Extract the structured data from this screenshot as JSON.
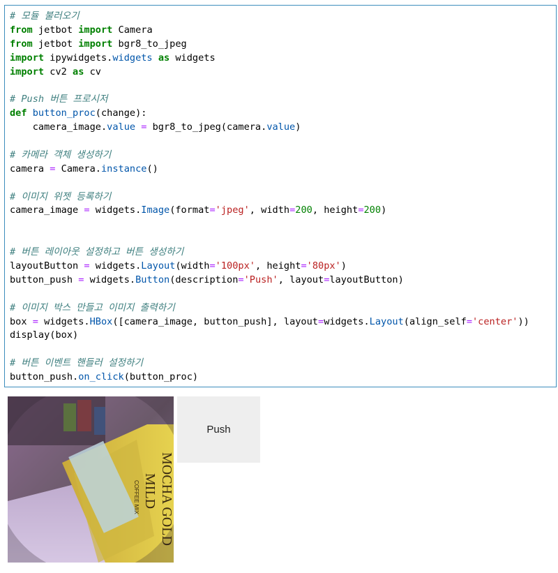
{
  "code_cell": {
    "lines": [
      [
        {
          "t": "comment",
          "v": "# 모듈 불러오기"
        }
      ],
      [
        {
          "t": "kw",
          "v": "from"
        },
        {
          "t": "plain",
          "v": " jetbot "
        },
        {
          "t": "kw",
          "v": "import"
        },
        {
          "t": "plain",
          "v": " Camera"
        }
      ],
      [
        {
          "t": "kw",
          "v": "from"
        },
        {
          "t": "plain",
          "v": " jetbot "
        },
        {
          "t": "kw",
          "v": "import"
        },
        {
          "t": "plain",
          "v": " bgr8_to_jpeg"
        }
      ],
      [
        {
          "t": "kw",
          "v": "import"
        },
        {
          "t": "plain",
          "v": " ipywidgets."
        },
        {
          "t": "attr",
          "v": "widgets"
        },
        {
          "t": "plain",
          "v": " "
        },
        {
          "t": "kw",
          "v": "as"
        },
        {
          "t": "plain",
          "v": " widgets"
        }
      ],
      [
        {
          "t": "kw",
          "v": "import"
        },
        {
          "t": "plain",
          "v": " cv2 "
        },
        {
          "t": "kw",
          "v": "as"
        },
        {
          "t": "plain",
          "v": " cv"
        }
      ],
      [],
      [
        {
          "t": "comment",
          "v": "# Push 버튼 프로시저"
        }
      ],
      [
        {
          "t": "kw",
          "v": "def"
        },
        {
          "t": "plain",
          "v": " "
        },
        {
          "t": "attr",
          "v": "button_proc"
        },
        {
          "t": "plain",
          "v": "(change):"
        }
      ],
      [
        {
          "t": "plain",
          "v": "    camera_image."
        },
        {
          "t": "attr",
          "v": "value"
        },
        {
          "t": "plain",
          "v": " "
        },
        {
          "t": "op",
          "v": "="
        },
        {
          "t": "plain",
          "v": " bgr8_to_jpeg(camera."
        },
        {
          "t": "attr",
          "v": "value"
        },
        {
          "t": "plain",
          "v": ")"
        }
      ],
      [],
      [
        {
          "t": "comment",
          "v": "# 카메라 객체 생성하기"
        }
      ],
      [
        {
          "t": "plain",
          "v": "camera "
        },
        {
          "t": "op",
          "v": "="
        },
        {
          "t": "plain",
          "v": " Camera."
        },
        {
          "t": "attr",
          "v": "instance"
        },
        {
          "t": "plain",
          "v": "()"
        }
      ],
      [],
      [
        {
          "t": "comment",
          "v": "# 이미지 위젯 등록하기"
        }
      ],
      [
        {
          "t": "plain",
          "v": "camera_image "
        },
        {
          "t": "op",
          "v": "="
        },
        {
          "t": "plain",
          "v": " widgets."
        },
        {
          "t": "attr",
          "v": "Image"
        },
        {
          "t": "plain",
          "v": "(format"
        },
        {
          "t": "op",
          "v": "="
        },
        {
          "t": "str",
          "v": "'jpeg'"
        },
        {
          "t": "plain",
          "v": ", width"
        },
        {
          "t": "op",
          "v": "="
        },
        {
          "t": "num",
          "v": "200"
        },
        {
          "t": "plain",
          "v": ", height"
        },
        {
          "t": "op",
          "v": "="
        },
        {
          "t": "num",
          "v": "200"
        },
        {
          "t": "plain",
          "v": ")"
        }
      ],
      [],
      [],
      [
        {
          "t": "comment",
          "v": "# 버튼 레이아웃 설정하고 버튼 생성하기"
        }
      ],
      [
        {
          "t": "plain",
          "v": "layoutButton "
        },
        {
          "t": "op",
          "v": "="
        },
        {
          "t": "plain",
          "v": " widgets."
        },
        {
          "t": "attr",
          "v": "Layout"
        },
        {
          "t": "plain",
          "v": "(width"
        },
        {
          "t": "op",
          "v": "="
        },
        {
          "t": "str",
          "v": "'100px'"
        },
        {
          "t": "plain",
          "v": ", height"
        },
        {
          "t": "op",
          "v": "="
        },
        {
          "t": "str",
          "v": "'80px'"
        },
        {
          "t": "plain",
          "v": ")"
        }
      ],
      [
        {
          "t": "plain",
          "v": "button_push "
        },
        {
          "t": "op",
          "v": "="
        },
        {
          "t": "plain",
          "v": " widgets."
        },
        {
          "t": "attr",
          "v": "Button"
        },
        {
          "t": "plain",
          "v": "(description"
        },
        {
          "t": "op",
          "v": "="
        },
        {
          "t": "str",
          "v": "'Push'"
        },
        {
          "t": "plain",
          "v": ", layout"
        },
        {
          "t": "op",
          "v": "="
        },
        {
          "t": "plain",
          "v": "layoutButton)"
        }
      ],
      [],
      [
        {
          "t": "comment",
          "v": "# 이미지 박스 만들고 이미지 출력하기"
        }
      ],
      [
        {
          "t": "plain",
          "v": "box "
        },
        {
          "t": "op",
          "v": "="
        },
        {
          "t": "plain",
          "v": " widgets."
        },
        {
          "t": "attr",
          "v": "HBox"
        },
        {
          "t": "plain",
          "v": "([camera_image, button_push], layout"
        },
        {
          "t": "op",
          "v": "="
        },
        {
          "t": "plain",
          "v": "widgets."
        },
        {
          "t": "attr",
          "v": "Layout"
        },
        {
          "t": "plain",
          "v": "(align_self"
        },
        {
          "t": "op",
          "v": "="
        },
        {
          "t": "str",
          "v": "'center'"
        },
        {
          "t": "plain",
          "v": "))"
        }
      ],
      [
        {
          "t": "plain",
          "v": "display(box)"
        }
      ],
      [],
      [
        {
          "t": "comment",
          "v": "# 버튼 이벤트 핸들러 설정하기"
        }
      ],
      [
        {
          "t": "plain",
          "v": "button_push."
        },
        {
          "t": "attr",
          "v": "on_click"
        },
        {
          "t": "plain",
          "v": "(button_proc)"
        }
      ]
    ]
  },
  "output": {
    "image_label_line1": "MOCHA GOLD",
    "image_label_line2": "MILD",
    "image_label_line3": "COFFEE MIX",
    "push_button_label": "Push"
  },
  "colors": {
    "cell_border": "#3c8dbc",
    "keyword": "#008000",
    "comment": "#408080",
    "string": "#ba2121",
    "operator": "#aa22ff",
    "attribute": "#0055aa",
    "button_bg": "#eeeeee"
  }
}
